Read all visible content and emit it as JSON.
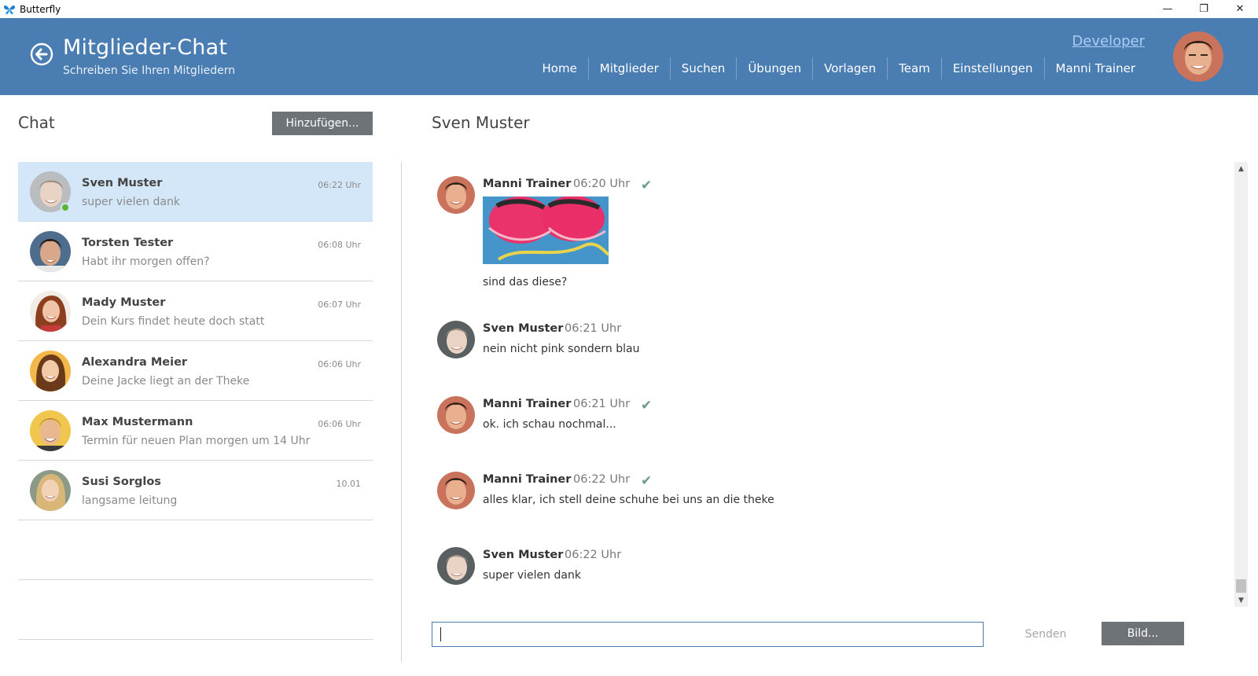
{
  "window": {
    "app_name": "Butterfly",
    "minimize": "—",
    "maximize": "❐",
    "close": "✕"
  },
  "header": {
    "title": "Mitglieder-Chat",
    "subtitle": "Schreiben Sie Ihren Mitgliedern",
    "developer_link": "Developer",
    "nav": [
      "Home",
      "Mitglieder",
      "Suchen",
      "Übungen",
      "Vorlagen",
      "Team",
      "Einstellungen",
      "Manni Trainer"
    ],
    "accent_color": "#4a7db2"
  },
  "left_panel": {
    "title": "Chat",
    "add_button": "Hinzufügen...",
    "chats": [
      {
        "name": "Sven Muster",
        "message": "super vielen dank",
        "time": "06:22 Uhr",
        "active": true,
        "online": true
      },
      {
        "name": "Torsten Tester",
        "message": "Habt ihr morgen offen?",
        "time": "06:08 Uhr"
      },
      {
        "name": "Mady Muster",
        "message": "Dein Kurs findet heute doch statt",
        "time": "06:07 Uhr"
      },
      {
        "name": "Alexandra Meier",
        "message": "Deine Jacke liegt an der Theke",
        "time": "06:06 Uhr"
      },
      {
        "name": "Max Mustermann",
        "message": "Termin für neuen Plan morgen um 14 Uhr",
        "time": "06:06 Uhr"
      },
      {
        "name": "Susi Sorglos",
        "message": "langsame leitung",
        "time": "10.01"
      }
    ]
  },
  "conversation": {
    "title": "Sven Muster",
    "messages": [
      {
        "sender": "Manni Trainer",
        "time": "06:20 Uhr",
        "text": "sind das diese?",
        "has_image": true,
        "delivered": true
      },
      {
        "sender": "Sven Muster",
        "time": "06:21 Uhr",
        "text": "nein nicht pink sondern blau"
      },
      {
        "sender": "Manni Trainer",
        "time": "06:21 Uhr",
        "text": "ok. ich schau nochmal...",
        "delivered": true
      },
      {
        "sender": "Manni Trainer",
        "time": "06:22 Uhr",
        "text": "alles klar, ich stell deine schuhe bei uns an die theke",
        "delivered": true
      },
      {
        "sender": "Sven Muster",
        "time": "06:22 Uhr",
        "text": "super vielen dank"
      }
    ],
    "check_glyph": "✔",
    "input_value": "",
    "send_button": "Senden",
    "image_button": "Bild..."
  }
}
